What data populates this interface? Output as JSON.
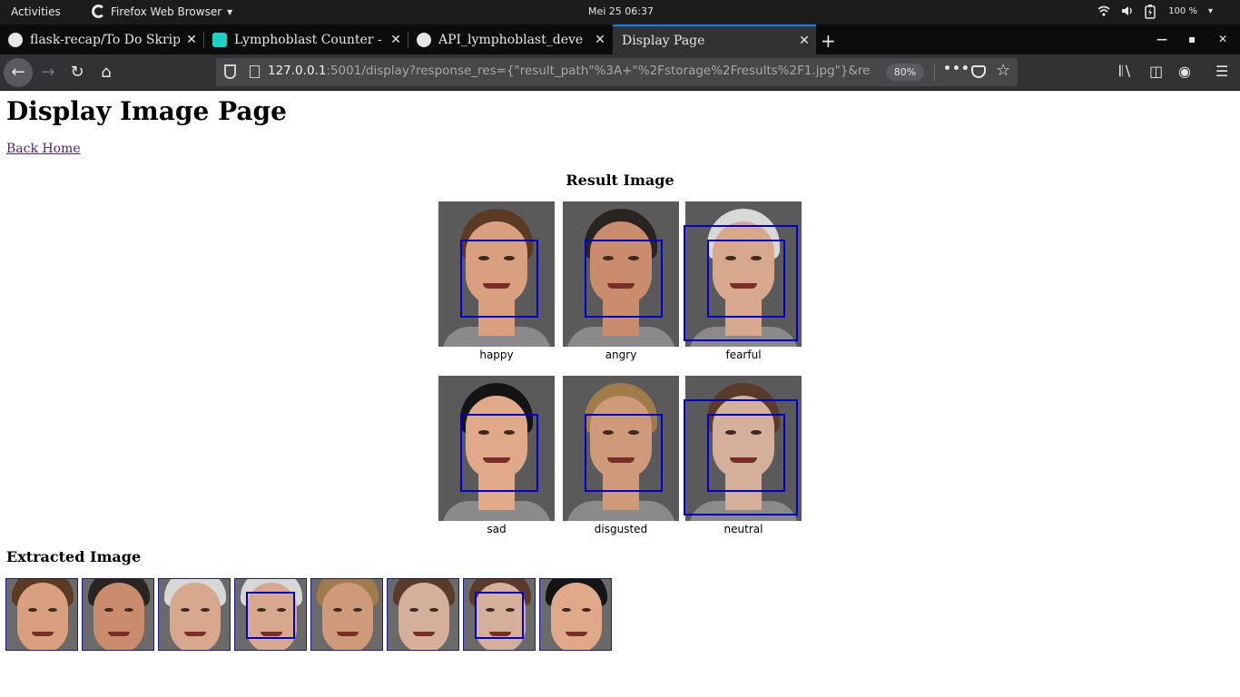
{
  "system_bar": {
    "activities": "Activities",
    "app_name": "Firefox Web Browser",
    "clock": "Mei 25  06:37",
    "battery": "100 %"
  },
  "tabs": [
    {
      "title": "flask-recap/To Do Skrip",
      "favicon": "github-icon",
      "active": false
    },
    {
      "title": "Lymphoblast Counter - ",
      "favicon": "app-icon",
      "active": false
    },
    {
      "title": "API_lymphoblast_deve",
      "favicon": "github-icon",
      "active": false
    },
    {
      "title": "Display Page",
      "favicon": "",
      "active": true
    }
  ],
  "navbar": {
    "url_host": "127.0.0.1",
    "url_rest": ":5001/display?response_res={\"result_path\"%3A+\"%2Fstorage%2Fresults%2F1.jpg\"}&re",
    "zoom": "80%"
  },
  "page": {
    "heading": "Display Image Page",
    "back_link": "Back Home",
    "result_heading": "Result Image",
    "extracted_heading": "Extracted Image"
  },
  "result_faces": [
    {
      "label": "happy",
      "skin": "#d9a080",
      "hair": "#5a3a22",
      "bbox_count": 1
    },
    {
      "label": "angry",
      "skin": "#c98c6c",
      "hair": "#2a2420",
      "bbox_count": 1
    },
    {
      "label": "fearful",
      "skin": "#d8a88e",
      "hair": "#d8d8d8",
      "bbox_count": 2
    },
    {
      "label": "sad",
      "skin": "#e0aa8a",
      "hair": "#141414",
      "bbox_count": 1
    },
    {
      "label": "disgusted",
      "skin": "#cf9a7a",
      "hair": "#a07c4a",
      "bbox_count": 1
    },
    {
      "label": "neutral",
      "skin": "#d4b09a",
      "hair": "#5a3a28",
      "bbox_count": 2
    }
  ],
  "extracted_faces": [
    {
      "face": "happy",
      "skin": "#d9a080",
      "hair": "#5a3a22",
      "has_inner_box": false
    },
    {
      "face": "angry",
      "skin": "#c98c6c",
      "hair": "#2a2420",
      "has_inner_box": false
    },
    {
      "face": "fearful",
      "skin": "#d8a88e",
      "hair": "#d8d8d8",
      "has_inner_box": false
    },
    {
      "face": "fearful",
      "skin": "#d8a88e",
      "hair": "#d8d8d8",
      "has_inner_box": true
    },
    {
      "face": "disgusted",
      "skin": "#cf9a7a",
      "hair": "#a07c4a",
      "has_inner_box": false
    },
    {
      "face": "neutral",
      "skin": "#d4b09a",
      "hair": "#5a3a28",
      "has_inner_box": false
    },
    {
      "face": "neutral",
      "skin": "#d4b09a",
      "hair": "#5a3a28",
      "has_inner_box": true
    },
    {
      "face": "sad",
      "skin": "#e0aa8a",
      "hair": "#141414",
      "has_inner_box": false
    }
  ],
  "colors": {
    "bbox": "#0000cc",
    "visited_link": "#551a8b",
    "active_tab_accent": "#0a84ff"
  }
}
